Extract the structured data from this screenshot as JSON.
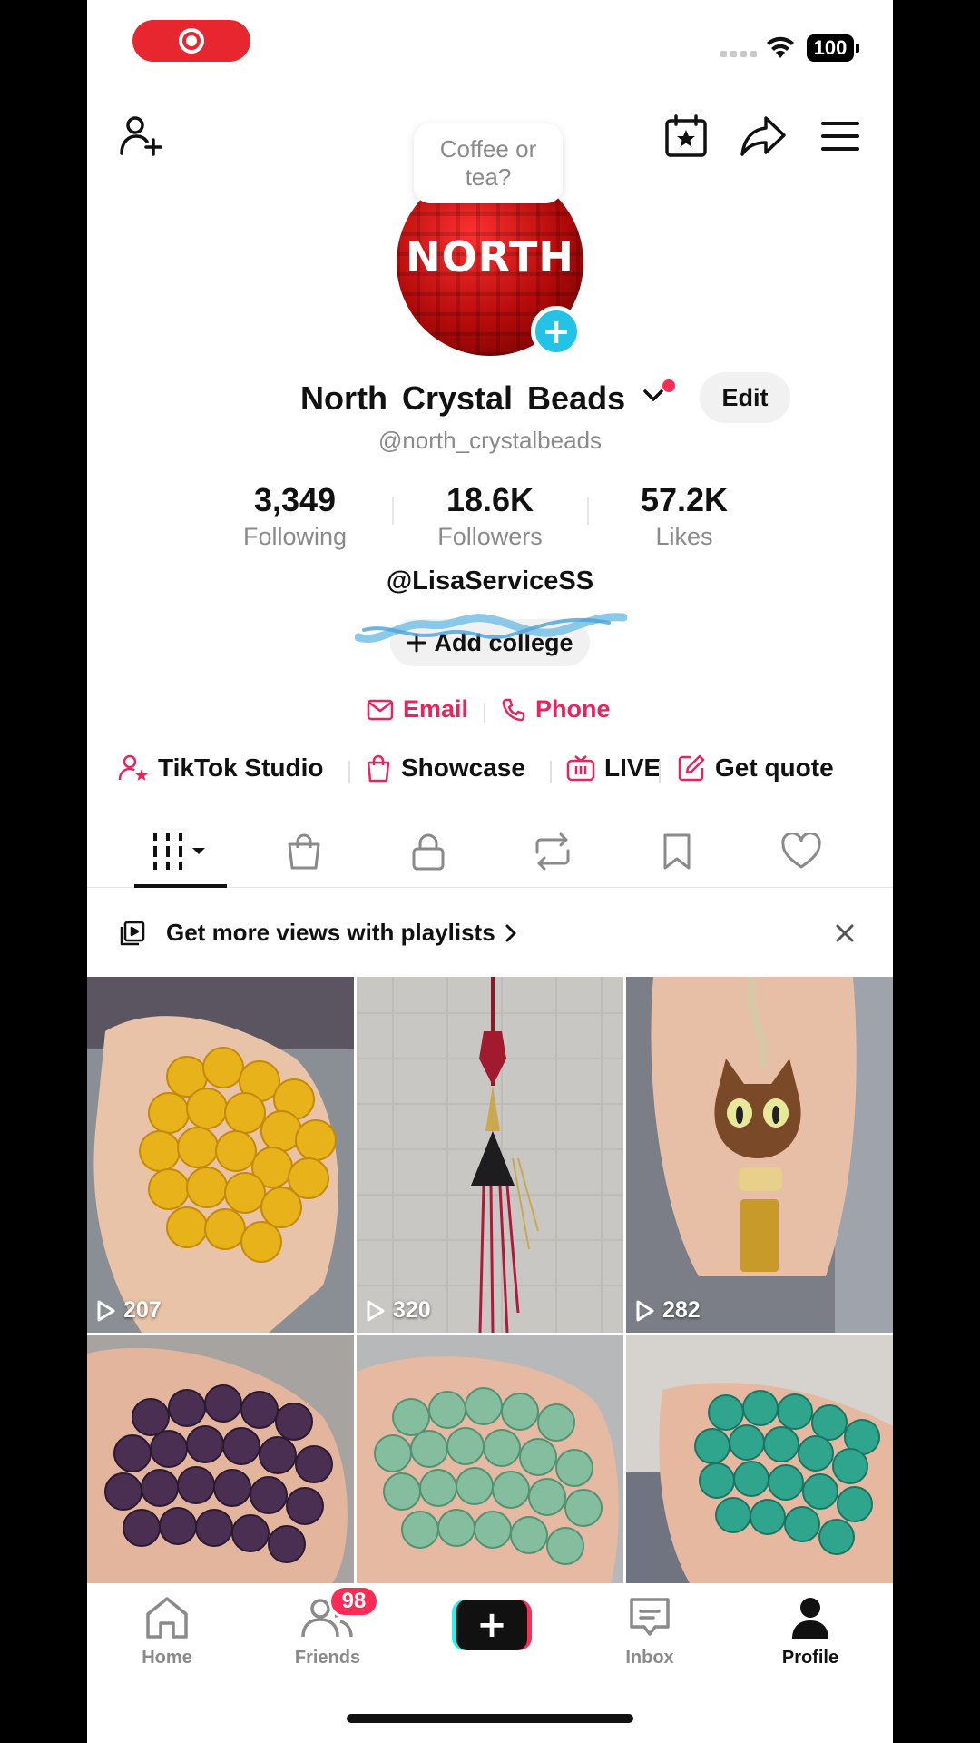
{
  "status_bar": {
    "battery": "100"
  },
  "bubble": {
    "text": "Coffee or tea?"
  },
  "avatar": {
    "logo_text": "NORTH"
  },
  "profile": {
    "display_name": "North Crystal Beads",
    "handle": "@north_crystalbeads",
    "edit_label": "Edit",
    "bio_mention": "@LisaServiceSS",
    "add_college": "Add college"
  },
  "stats": [
    {
      "value": "3,349",
      "label": "Following"
    },
    {
      "value": "18.6K",
      "label": "Followers"
    },
    {
      "value": "57.2K",
      "label": "Likes"
    }
  ],
  "contacts": {
    "email": "Email",
    "phone": "Phone"
  },
  "tools": {
    "studio": "TikTok Studio",
    "showcase": "Showcase",
    "live": "LIVE",
    "quote": "Get quote"
  },
  "playlist_banner": {
    "text": "Get more views with playlists"
  },
  "videos": [
    {
      "views": "207"
    },
    {
      "views": "320"
    },
    {
      "views": "282"
    },
    {
      "views": ""
    },
    {
      "views": ""
    },
    {
      "views": ""
    }
  ],
  "nav": {
    "home": "Home",
    "friends": "Friends",
    "friends_badge": "98",
    "inbox": "Inbox",
    "profile": "Profile"
  },
  "colors": {
    "accent": "#fe2c55",
    "link": "#e8245e",
    "cyan": "#25f4ee"
  }
}
